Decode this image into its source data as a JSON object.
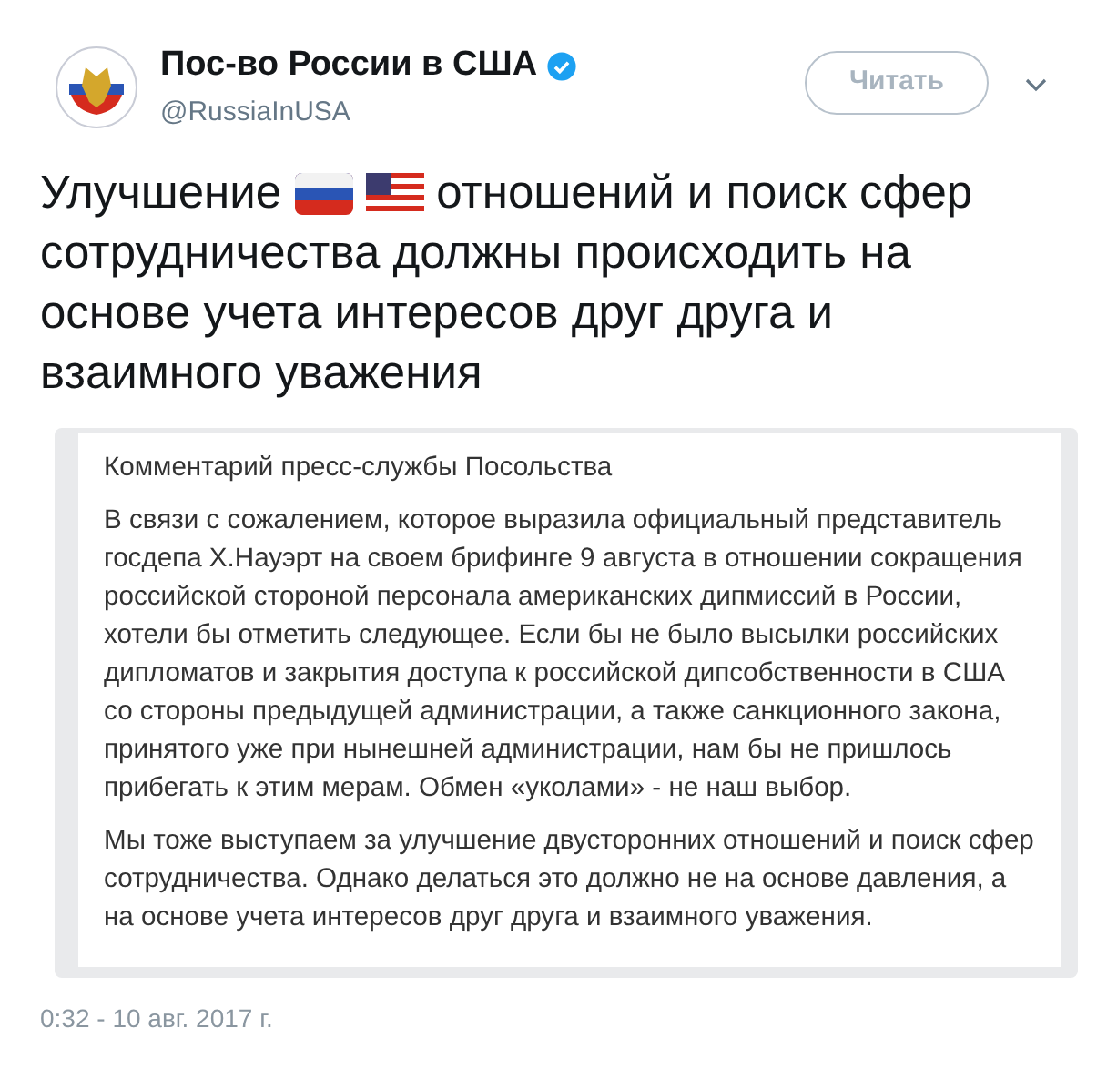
{
  "account": {
    "name": "Пос-во России в США",
    "verified": true,
    "handle": "@RussiaInUSA"
  },
  "follow_button": "Читать",
  "tweet": {
    "text_before": "Улучшение",
    "text_after": "отношений и поиск сфер",
    "text_rest": "сотрудничества должны происходить на основе учета интересов друг друга и взаимного уважения"
  },
  "document": {
    "title": "Комментарий пресс-службы Посольства",
    "paragraphs": [
      "В связи с сожалением, которое выразила официальный представитель госдепа Х.Науэрт на своем брифинге 9 августа в отношении сокращения российской стороной персонала американских дипмиссий в России, хотели бы отметить следующее. Если бы не было высылки российских дипломатов и закрытия доступа к российской дипсобственности в США со стороны предыдущей администрации, а также санкционного закона, принятого уже при нынешней администрации, нам бы не пришлось прибегать к этим мерам. Обмен «уколами» - не наш выбор.",
      "Мы тоже выступаем за улучшение двусторонних отношений и поиск сфер сотрудничества. Однако делаться это должно не на основе давления, а на основе учета интересов друг друга и взаимного уважения."
    ]
  },
  "timestamp": "0:32 - 10 авг. 2017 г."
}
